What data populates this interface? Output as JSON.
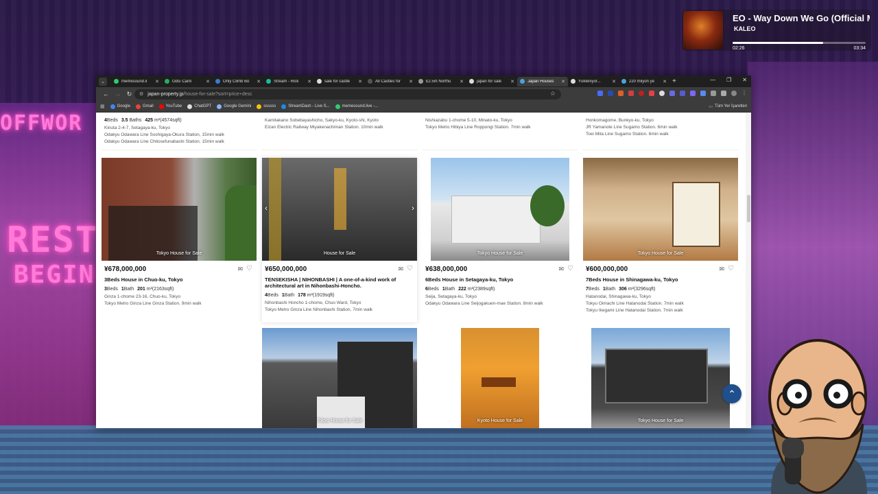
{
  "music": {
    "title": "EO - Way Down We Go (Official Mu",
    "artist": "KALEO",
    "time_current": "02:26",
    "time_total": "03:34",
    "progress": 0.68
  },
  "backdrop": {
    "neon_top": "OFFWOR",
    "neon_mid": "REST",
    "neon_low": "BEGIN"
  },
  "browser": {
    "tabs": [
      {
        "label": "memesound.li",
        "color": "#2ecc71",
        "active": false
      },
      {
        "label": "Odsı Canlı",
        "color": "#27ae60",
        "active": false
      },
      {
        "label": "Only Climb Bo",
        "color": "#3a7bd5",
        "active": false
      },
      {
        "label": "Stream - Rick",
        "color": "#1abc9c",
        "active": false
      },
      {
        "label": "sale for castle",
        "color": "#ddd",
        "active": false
      },
      {
        "label": "All Castles for",
        "color": "#555",
        "active": false
      },
      {
        "label": "£2.5m Northu",
        "color": "#999",
        "active": false
      },
      {
        "label": "japan for sale",
        "color": "#ddd",
        "active": false
      },
      {
        "label": "Japan Houses",
        "color": "#4aa3df",
        "active": true
      },
      {
        "label": "Yükleniyor...",
        "color": "#ddd",
        "active": false
      },
      {
        "label": "220 milyon ye",
        "color": "#4aa3df",
        "active": false
      }
    ],
    "url_host": "japan-property.jp",
    "url_path": "/house-for-sale?sort=price+desc",
    "bookmarks": [
      {
        "label": "Google",
        "color": "#4285f4"
      },
      {
        "label": "Gmail",
        "color": "#ea4335"
      },
      {
        "label": "YouTube",
        "color": "#ff0000"
      },
      {
        "label": "ChatGPT",
        "color": "#ddd"
      },
      {
        "label": "Google Gemini",
        "color": "#8ab4f8"
      },
      {
        "label": "ssssss",
        "color": "#f4c20d"
      },
      {
        "label": "StreamDash - Live S...",
        "color": "#1e88e5"
      },
      {
        "label": "memesound.live -...",
        "color": "#2ecc71"
      }
    ],
    "other_bookmarks": "Tüm Yer İşaretleri"
  },
  "prev_row": [
    {
      "specs": {
        "beds": "4",
        "baths": "3.5",
        "size": "425",
        "sqft": "(4574sqft)"
      },
      "line1": "Kinuta 2-4-7, Setagaya-ku, Tokyo",
      "line2": "Odakyu Odawara Line Soshigaya-Okura Station, 15min walk",
      "line3": "Odakyu Odawara Line Chitosefunabashi Station. 15min walk"
    },
    {
      "line1": "Kamitakano Sobebayashicho, Sakyo-ku, Kyoto-shi, Kyoto",
      "line2": "Eizan Electric Railway Miyakenachiman Station. 10min walk"
    },
    {
      "line1": "Nishiazabu 1-chome 5-10, Minato-ku, Tokyo",
      "line2": "Tokyo Metro Hibiya Line Roppongi Station. 7min walk"
    },
    {
      "line1": "Honkomagome, Bunkyo-ku, Tokyo",
      "line2": "JR Yamanote Line Sugamo Station. 6min walk",
      "line3": "Toei Mita Line Sugamo Station. 6min walk"
    }
  ],
  "listings": [
    {
      "img_label": "Tokyo House for Sale",
      "price": "¥678,000,000",
      "title": "3Beds House in Chuo-ku, Tokyo",
      "beds": "3",
      "baths": "1",
      "size": "201",
      "sqft": "(2163sqft)",
      "address": "Ginza 1-chome 23-16, Chuo-ku, Tokyo",
      "station1": "Tokyo Metro Ginza Line Ginza Station. 9min walk",
      "station2": ""
    },
    {
      "img_label": "House for Sale",
      "price": "¥650,000,000",
      "title": "TENSEKISHA | NIHONBASHI | A one-of-a-kind work of architectural art in Nihonbashi-Honcho.",
      "beds": "4",
      "baths": "1",
      "size": "178",
      "sqft": "(1919sqft)",
      "address": "Nihonbashi Honcho 1-chome, Chuo Ward, Tokyo",
      "station1": "Tokyo Metro Ginza Line Nihonbashi Station. 7min walk",
      "station2": ""
    },
    {
      "img_label": "Tokyo House for Sale",
      "price": "¥638,000,000",
      "title": "6Beds House in Setagaya-ku, Tokyo",
      "beds": "6",
      "baths": "1",
      "size": "222",
      "sqft": "(2389sqft)",
      "address": "Seija, Setagaya-ku, Tokyo",
      "station1": "Odakyu Odawara Line Seijogakuen-mae Station. 8min walk",
      "station2": ""
    },
    {
      "img_label": "Tokyo House for Sale",
      "price": "¥600,000,000",
      "title": "7Beds House in Shinagawa-ku, Tokyo",
      "beds": "7",
      "baths": "1",
      "size": "306",
      "sqft": "(3296sqft)",
      "address": "Hatanodai, Shinagawa-ku, Tokyo",
      "station1": "Tokyu Oimachi Line Hatanodai Station. 7min walk",
      "station2": "Tokyu Ikegami Line Hatanodai Station. 7min walk"
    }
  ],
  "next_row": [
    {
      "img_label": ""
    },
    {
      "img_label": "Tokyo House for Sale"
    },
    {
      "img_label": "Kyoto House for Sale"
    },
    {
      "img_label": "Tokyo House for Sale"
    }
  ],
  "labels": {
    "beds": "Beds",
    "baths": "Bath",
    "baths_plural": "Baths",
    "unit": "m²"
  }
}
